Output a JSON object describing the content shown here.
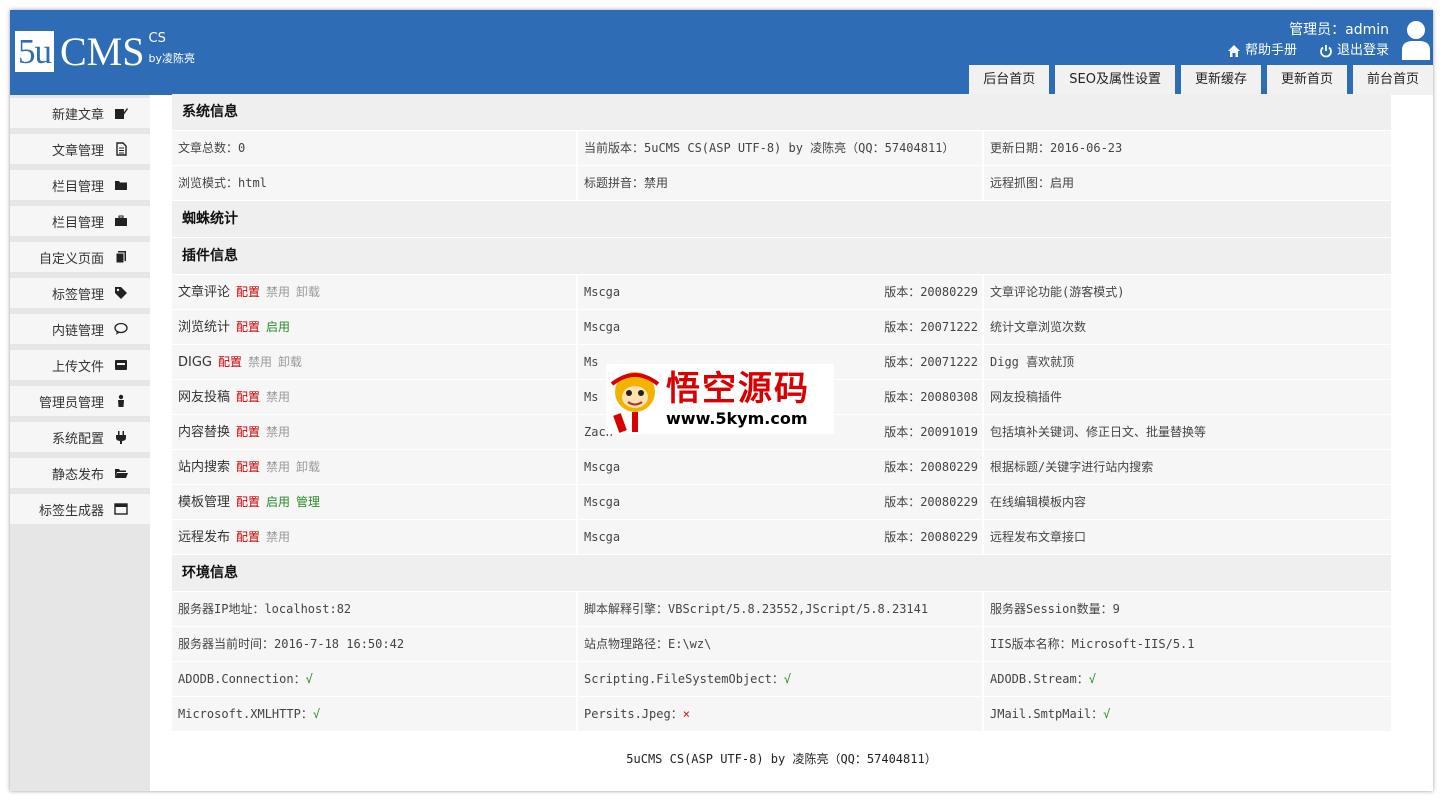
{
  "header": {
    "logo_5u": "5u",
    "logo_cms": "CMS",
    "logo_cs": "CS",
    "logo_by": "by凌陈亮",
    "admin_text": "管理员：admin",
    "help_label": "帮助手册",
    "logout_label": "退出登录",
    "tabs": [
      "后台首页",
      "SEO及属性设置",
      "更新缓存",
      "更新首页",
      "前台首页"
    ]
  },
  "sidebar": {
    "items": [
      {
        "label": "新建文章",
        "icon": "edit-icon"
      },
      {
        "label": "文章管理",
        "icon": "document-icon"
      },
      {
        "label": "栏目管理",
        "icon": "folder-icon"
      },
      {
        "label": "栏目管理",
        "icon": "briefcase-icon"
      },
      {
        "label": "自定义页面",
        "icon": "copy-icon"
      },
      {
        "label": "标签管理",
        "icon": "tag-icon"
      },
      {
        "label": "内链管理",
        "icon": "comment-icon"
      },
      {
        "label": "上传文件",
        "icon": "inbox-icon"
      },
      {
        "label": "管理员管理",
        "icon": "user-icon"
      },
      {
        "label": "系统配置",
        "icon": "plug-icon"
      },
      {
        "label": "静态发布",
        "icon": "folder-open-icon"
      },
      {
        "label": "标签生成器",
        "icon": "window-icon"
      }
    ]
  },
  "system": {
    "title": "系统信息",
    "rows": [
      [
        "文章总数：0",
        "当前版本：5uCMS CS(ASP UTF-8) by 凌陈亮（QQ：57404811）",
        "更新日期：2016-06-23"
      ],
      [
        "浏览模式：html",
        "标题拼音：禁用",
        "远程抓图：启用"
      ]
    ]
  },
  "spider": {
    "title": "蜘蛛统计"
  },
  "plugins": {
    "title": "插件信息",
    "version_prefix": "版本：",
    "rows": [
      {
        "name": "文章评论",
        "actions": [
          {
            "t": "配置",
            "c": "red"
          },
          {
            "t": "禁用",
            "c": "gray"
          },
          {
            "t": "卸载",
            "c": "gray"
          }
        ],
        "author": "Mscga",
        "version": "20080229",
        "desc": "文章评论功能(游客模式)"
      },
      {
        "name": "浏览统计",
        "actions": [
          {
            "t": "配置",
            "c": "red"
          },
          {
            "t": "启用",
            "c": "green"
          }
        ],
        "author": "Mscga",
        "version": "20071222",
        "desc": "统计文章浏览次数"
      },
      {
        "name": "DIGG",
        "actions": [
          {
            "t": "配置",
            "c": "red"
          },
          {
            "t": "禁用",
            "c": "gray"
          },
          {
            "t": "卸载",
            "c": "gray"
          }
        ],
        "author": "Ms",
        "version": "20071222",
        "desc": "Digg 喜欢就顶"
      },
      {
        "name": "网友投稿",
        "actions": [
          {
            "t": "配置",
            "c": "red"
          },
          {
            "t": "禁用",
            "c": "gray"
          }
        ],
        "author": "Ms",
        "version": "20080308",
        "desc": "网友投稿插件"
      },
      {
        "name": "内容替换",
        "actions": [
          {
            "t": "配置",
            "c": "red"
          },
          {
            "t": "禁用",
            "c": "gray"
          }
        ],
        "author": "Zach",
        "version": "20091019",
        "desc": "包括填补关键词、修正日文、批量替换等"
      },
      {
        "name": "站内搜索",
        "actions": [
          {
            "t": "配置",
            "c": "red"
          },
          {
            "t": "禁用",
            "c": "gray"
          },
          {
            "t": "卸载",
            "c": "gray"
          }
        ],
        "author": "Mscga",
        "version": "20080229",
        "desc": "根据标题/关键字进行站内搜索"
      },
      {
        "name": "模板管理",
        "actions": [
          {
            "t": "配置",
            "c": "red"
          },
          {
            "t": "启用",
            "c": "green"
          },
          {
            "t": "管理",
            "c": "green"
          }
        ],
        "author": "Mscga",
        "version": "20080229",
        "desc": "在线编辑模板内容"
      },
      {
        "name": "远程发布",
        "actions": [
          {
            "t": "配置",
            "c": "red"
          },
          {
            "t": "禁用",
            "c": "gray"
          }
        ],
        "author": "Mscga",
        "version": "20080229",
        "desc": "远程发布文章接口"
      }
    ]
  },
  "env": {
    "title": "环境信息",
    "rows": [
      [
        {
          "t": "服务器IP地址：localhost:82"
        },
        {
          "t": "脚本解释引擎：VBScript/5.8.23552,JScript/5.8.23141"
        },
        {
          "t": "服务器Session数量：9"
        }
      ],
      [
        {
          "t": "服务器当前时间：2016-7-18 16:50:42"
        },
        {
          "t": "站点物理路径：E:\\wz\\"
        },
        {
          "t": "IIS版本名称：Microsoft-IIS/5.1"
        }
      ],
      [
        {
          "t": "ADODB.Connection：",
          "m": "√",
          "ok": true
        },
        {
          "t": "Scripting.FileSystemObject：",
          "m": "√",
          "ok": true
        },
        {
          "t": "ADODB.Stream：",
          "m": "√",
          "ok": true
        }
      ],
      [
        {
          "t": "Microsoft.XMLHTTP：",
          "m": "√",
          "ok": true
        },
        {
          "t": "Persits.Jpeg：",
          "m": "×",
          "ok": false
        },
        {
          "t": "JMail.SmtpMail：",
          "m": "√",
          "ok": true
        }
      ]
    ]
  },
  "footer": {
    "text": "5uCMS CS(ASP UTF-8) by 凌陈亮（QQ：57404811）"
  },
  "watermark": {
    "cn": "悟空源码",
    "url": "www.5kym.com"
  }
}
